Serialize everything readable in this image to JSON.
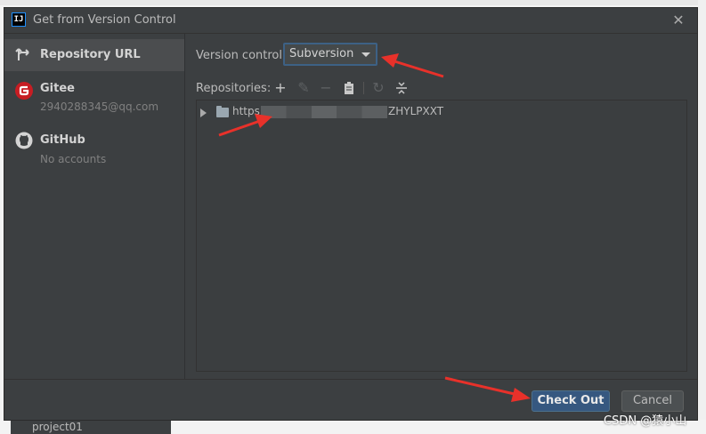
{
  "window": {
    "app_icon_text": "IJ",
    "title": "Get from Version Control",
    "close_icon": "close-icon"
  },
  "sidebar": {
    "items": [
      {
        "label": "Repository URL",
        "sub": "",
        "icon": "repository-url-icon",
        "selected": true
      },
      {
        "label": "Gitee",
        "sub": "2940288345@qq.com",
        "icon": "gitee-icon",
        "selected": false
      },
      {
        "label": "GitHub",
        "sub": "No accounts",
        "icon": "github-icon",
        "selected": false
      }
    ]
  },
  "main": {
    "version_control_label": "Version control:",
    "version_control_value": "Subversion",
    "repositories_label": "Repositories:",
    "toolbar": [
      "add-icon",
      "edit-icon",
      "remove-icon",
      "clipboard-icon",
      "refresh-icon",
      "collapse-icon"
    ],
    "repository": {
      "prefix": "https",
      "suffix": "ZHYLPXXT"
    }
  },
  "footer": {
    "checkout_label": "Check Out",
    "cancel_label": "Cancel"
  },
  "background": {
    "project_label": "project01",
    "watermark": "CSDN @猿小山"
  },
  "colors": {
    "dialog_bg": "#3c3f41",
    "accent": "#365880",
    "arrow": "#e8312a"
  }
}
